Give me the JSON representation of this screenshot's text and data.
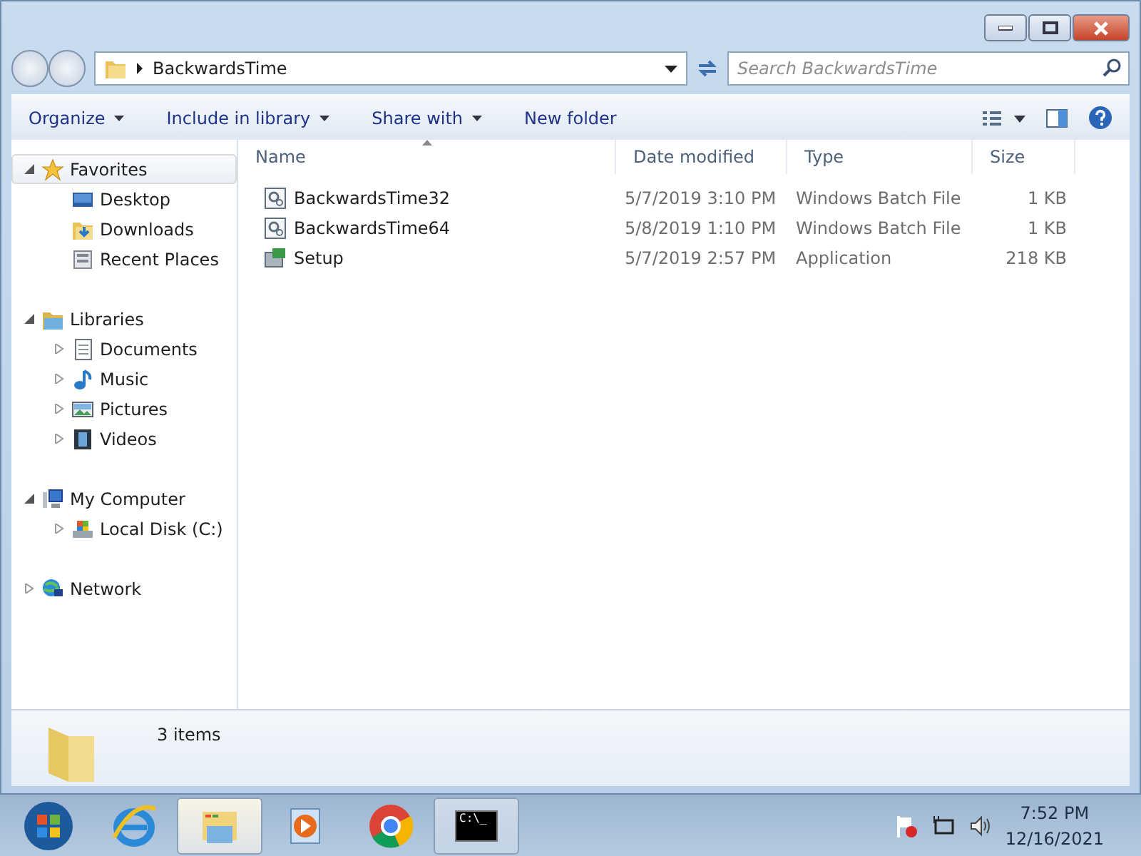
{
  "address": {
    "crumbs": [
      "BackwardsTime"
    ]
  },
  "search": {
    "placeholder": "Search BackwardsTime"
  },
  "toolbar": [
    {
      "label": "Organize",
      "dropdown": true
    },
    {
      "label": "Include in library",
      "dropdown": true
    },
    {
      "label": "Share with",
      "dropdown": true
    },
    {
      "label": "New folder",
      "dropdown": false
    }
  ],
  "sidebar": {
    "groups": [
      {
        "label": "Favorites",
        "kind": "star",
        "expanded": true,
        "selected": true,
        "children": [
          {
            "label": "Desktop",
            "kind": "desktop",
            "selected": false
          },
          {
            "label": "Downloads",
            "kind": "downloads",
            "selected": false
          },
          {
            "label": "Recent Places",
            "kind": "recent",
            "selected": false
          }
        ]
      },
      {
        "label": "Libraries",
        "kind": "library",
        "expanded": true,
        "selected": false,
        "children": [
          {
            "label": "Documents",
            "kind": "documents",
            "expanded": false,
            "selected": false
          },
          {
            "label": "Music",
            "kind": "music",
            "expanded": false,
            "selected": false
          },
          {
            "label": "Pictures",
            "kind": "pictures",
            "expanded": false,
            "selected": false
          },
          {
            "label": "Videos",
            "kind": "videos",
            "expanded": false,
            "selected": false
          }
        ]
      },
      {
        "label": "My Computer",
        "kind": "computer",
        "expanded": true,
        "selected": false,
        "children": [
          {
            "label": "Local Disk (C:)",
            "kind": "disk",
            "expanded": false,
            "selected": false
          }
        ]
      },
      {
        "label": "Network",
        "kind": "network",
        "expanded": false,
        "selected": false
      }
    ]
  },
  "table": {
    "columns": [
      {
        "label": "Name",
        "sorted": true
      },
      {
        "label": "Date modified",
        "sorted": false
      },
      {
        "label": "Type",
        "sorted": false
      },
      {
        "label": "Size",
        "sorted": false
      }
    ],
    "rows": [
      {
        "kind": "batch",
        "name": "BackwardsTime32",
        "date": "5/7/2019 3:10 PM",
        "type": "Windows Batch File",
        "size": "1 KB"
      },
      {
        "kind": "batch",
        "name": "BackwardsTime64",
        "date": "5/8/2019 1:10 PM",
        "type": "Windows Batch File",
        "size": "1 KB"
      },
      {
        "kind": "application",
        "name": "Setup",
        "date": "5/7/2019 2:57 PM",
        "type": "Application",
        "size": "218 KB"
      }
    ]
  },
  "details": {
    "count": "3 items"
  },
  "taskbar": {
    "items": [
      {
        "kind": "start",
        "active": false
      },
      {
        "kind": "ie",
        "active": false
      },
      {
        "kind": "explorer",
        "active": true
      },
      {
        "kind": "media",
        "active": false
      },
      {
        "kind": "chrome",
        "active": false
      },
      {
        "kind": "cmd",
        "active": false,
        "open": true,
        "label": "C:\\_"
      }
    ],
    "time": "7:52 PM",
    "date": "12/16/2021"
  }
}
